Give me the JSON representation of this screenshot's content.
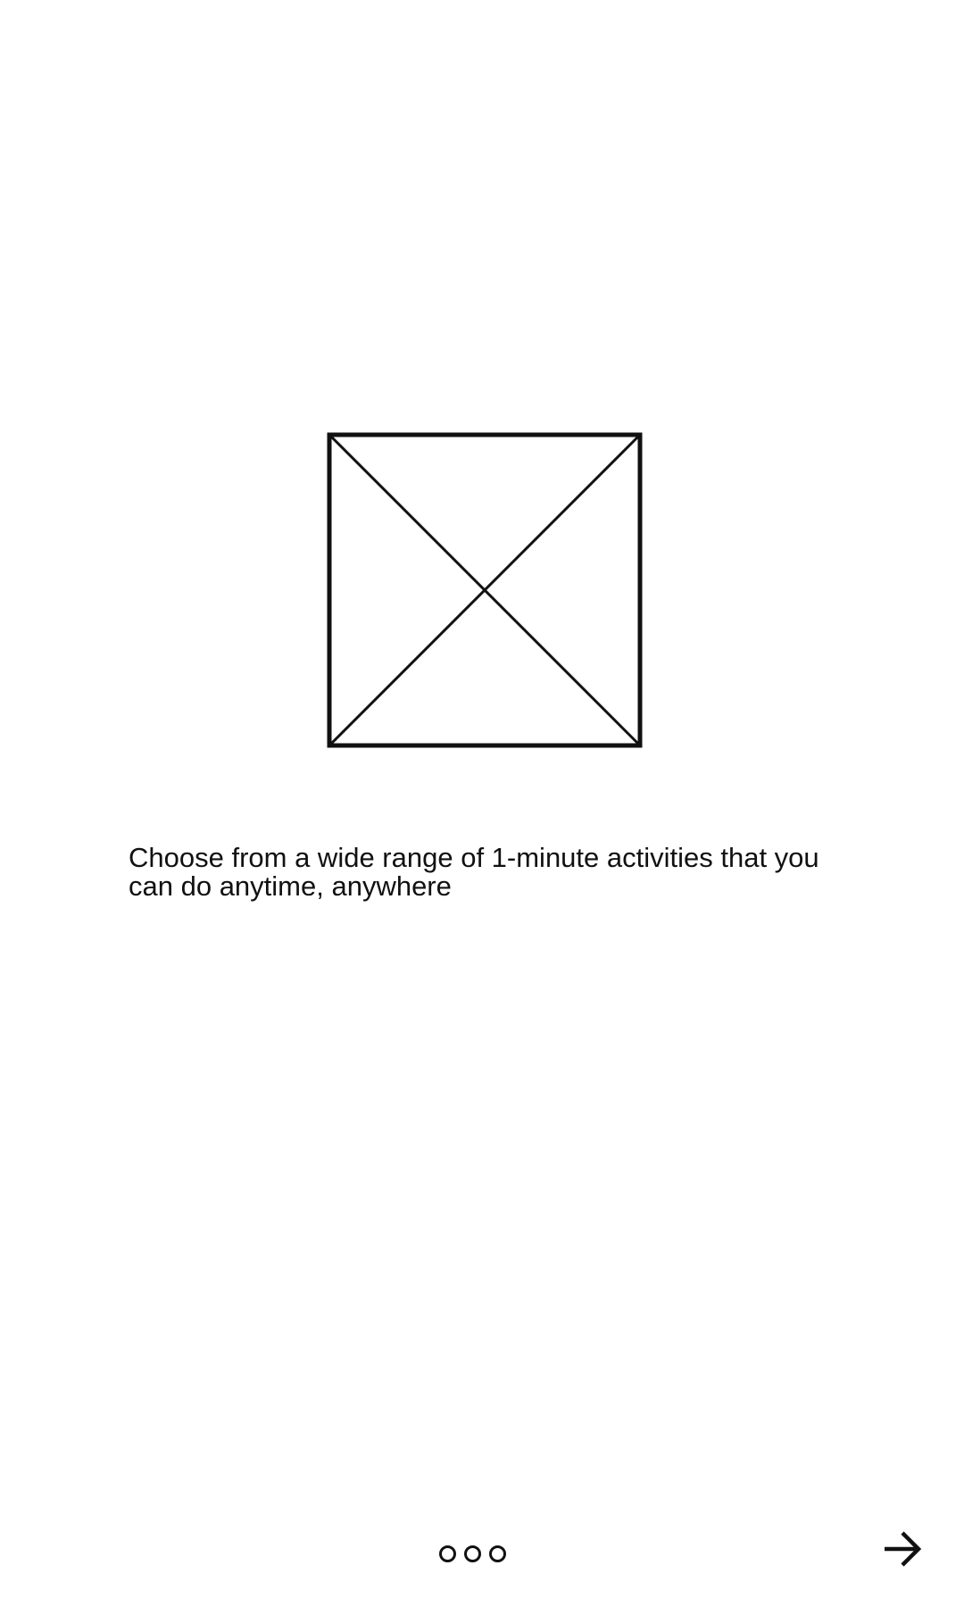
{
  "onboarding": {
    "image": {
      "icon": "image-placeholder-icon"
    },
    "description": "Choose from a wide range of 1-minute activities that you can do anytime, anywhere",
    "pager": {
      "total_pages": 3
    },
    "next_button": {
      "icon": "arrow-right-icon"
    }
  },
  "colors": {
    "background": "#ffffff",
    "foreground": "#111111"
  }
}
